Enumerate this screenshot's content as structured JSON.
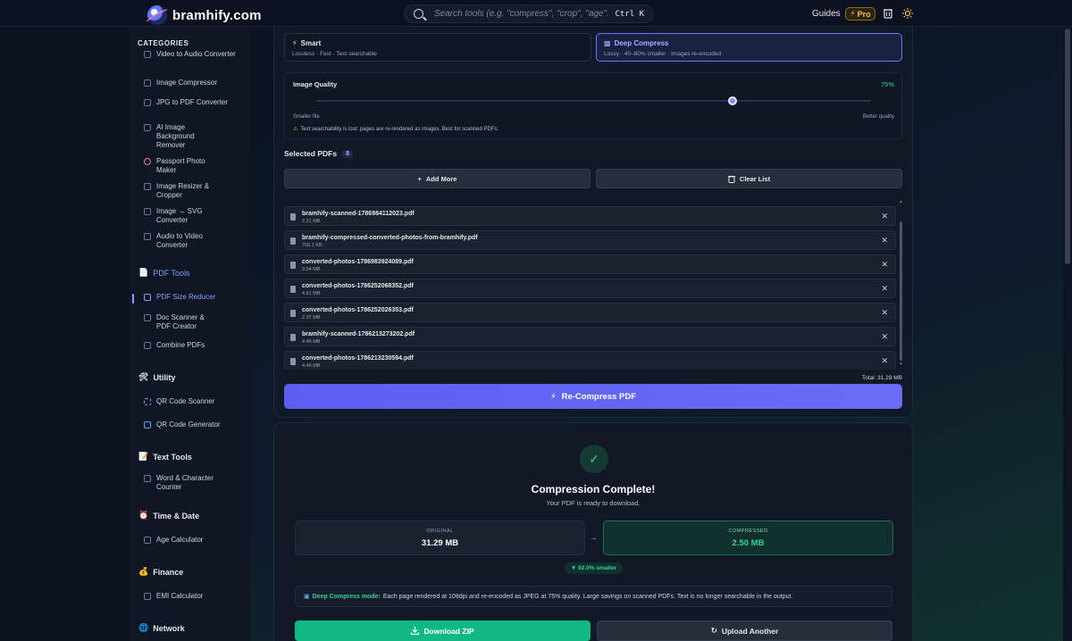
{
  "header": {
    "logo_text": "bramhify.com",
    "search_placeholder": "Search tools (e.g. \"compress\", \"crop\", \"age\"...)",
    "search_shortcut": "Ctrl K",
    "guides_label": "Guides",
    "pro_label": "Pro",
    "pro_icon": "⚡"
  },
  "sidebar": {
    "categories_heading": "CATEGORIES",
    "media_items": [
      {
        "label": "Video to Audio Converter"
      },
      {
        "label": "Image Compressor"
      },
      {
        "label": "JPG to PDF Converter"
      },
      {
        "label": "AI Image Background Remover"
      },
      {
        "label": "Passport Photo Maker"
      },
      {
        "label": "Image Resizer & Cropper"
      },
      {
        "label": "Image → SVG Converter"
      },
      {
        "label": "Audio to Video Converter"
      }
    ],
    "pdf_group": {
      "label": "PDF Tools",
      "icon": "📄"
    },
    "pdf_items": [
      {
        "label": "PDF Size Reducer"
      },
      {
        "label": "Doc Scanner & PDF Creator"
      },
      {
        "label": "Combine PDFs"
      }
    ],
    "utility_group": {
      "label": "Utility",
      "icon": "🛠"
    },
    "utility_items": [
      {
        "label": "QR Code Scanner"
      },
      {
        "label": "QR Code Generator"
      }
    ],
    "text_group": {
      "label": "Text Tools",
      "icon": "📝"
    },
    "text_items": [
      {
        "label": "Word & Character Counter"
      }
    ],
    "time_group": {
      "label": "Time & Date",
      "icon": "⏰"
    },
    "time_items": [
      {
        "label": "Age Calculator"
      }
    ],
    "finance_group": {
      "label": "Finance",
      "icon": "💰"
    },
    "finance_items": [
      {
        "label": "EMI Calculator"
      }
    ],
    "network_group": {
      "label": "Network",
      "icon": "🌐"
    }
  },
  "modes": {
    "smart": {
      "title": "Smart",
      "desc": "Lossless · Fast · Text searchable"
    },
    "deep": {
      "title": "Deep Compress",
      "desc": "Lossy · 40–80% smaller · Images re-encoded"
    }
  },
  "quality": {
    "label": "Image Quality",
    "value_text": "75%",
    "value": 75,
    "min_label": "Smaller file",
    "max_label": "Better quality",
    "warning": "Text searchability is lost: pages are re-rendered as images. Best for scanned PDFs."
  },
  "files": {
    "heading": "Selected PDFs",
    "count": "8",
    "add_more_label": "Add More",
    "clear_list_label": "Clear List",
    "items": [
      {
        "name": "bramhify-scanned-1786984112023.pdf",
        "size": "2.21 MB"
      },
      {
        "name": "bramhify-compressed-converted-photos-from-bramhify.pdf",
        "size": "755.1 KB"
      },
      {
        "name": "converted-photos-1786983924089.pdf",
        "size": "9.54 MB"
      },
      {
        "name": "converted-photos-1786252068352.pdf",
        "size": "4.61 MB"
      },
      {
        "name": "converted-photos-1786252026353.pdf",
        "size": "2.37 MB"
      },
      {
        "name": "bramhify-scanned-1786213273202.pdf",
        "size": "4.46 MB"
      },
      {
        "name": "converted-photos-1786213230594.pdf",
        "size": "4.46 MB"
      }
    ],
    "total_text": "Total: 31.29 MB",
    "recompress_label": "Re-Compress PDF"
  },
  "result": {
    "title": "Compression Complete!",
    "subtitle": "Your PDF is ready to download.",
    "original_label": "ORIGINAL",
    "original_value": "31.29 MB",
    "compressed_label": "COMPRESSED",
    "compressed_value": "2.50 MB",
    "reduction": "▼ 92.0% smaller",
    "info_mode": "Deep Compress mode:",
    "info_text": "Each page rendered at 108dpi and re-encoded as JPEG at 75% quality. Large savings on scanned PDFs. Text is no longer searchable in the output.",
    "download_label": "Download ZIP",
    "upload_label": "Upload Another"
  },
  "colors": {
    "accent": "#6366f1",
    "success": "#10b981",
    "background": "#0b1220"
  }
}
